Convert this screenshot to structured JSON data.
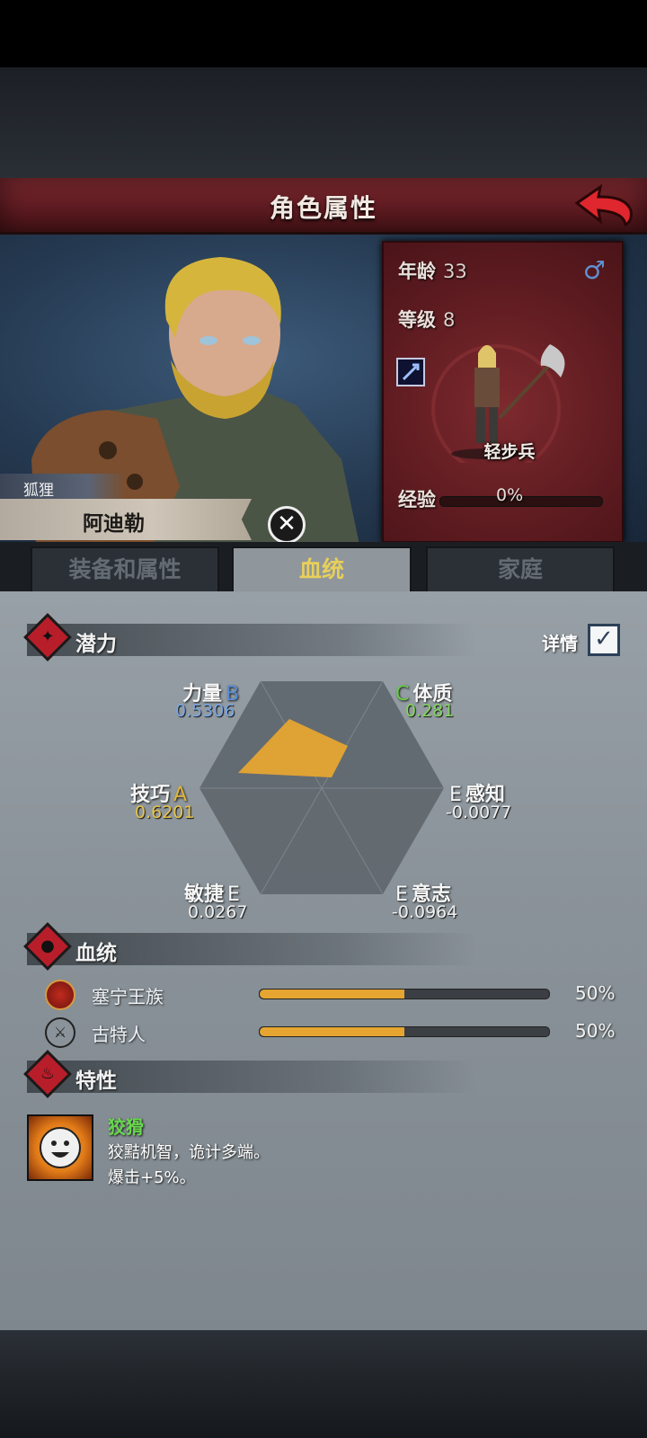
{
  "header": {
    "title": "角色属性"
  },
  "character": {
    "tag": "狐狸",
    "name": "阿迪勒",
    "age_label": "年龄",
    "age": "33",
    "level_label": "等级",
    "level": "8",
    "unit_type": "轻步兵",
    "exp_label": "经验",
    "exp_value": "0%",
    "exp_fraction": 0,
    "gender_icon": "male-symbol-icon"
  },
  "tabs": [
    {
      "label": "装备和属性",
      "active": false
    },
    {
      "label": "血统",
      "active": true
    },
    {
      "label": "家庭",
      "active": false
    }
  ],
  "potential": {
    "title": "潜力",
    "detail_label": "详情",
    "detail_checked": true,
    "stats": [
      {
        "name": "力量",
        "grade": "B",
        "value": "0.5306"
      },
      {
        "name": "体质",
        "grade": "C",
        "value": "0.281"
      },
      {
        "name": "感知",
        "grade": "E",
        "value": "-0.0077"
      },
      {
        "name": "意志",
        "grade": "E",
        "value": "-0.0964"
      },
      {
        "name": "敏捷",
        "grade": "E",
        "value": "0.0267"
      },
      {
        "name": "技巧",
        "grade": "A",
        "value": "0.6201"
      }
    ]
  },
  "lineage": {
    "title": "血统",
    "items": [
      {
        "name": "塞宁王族",
        "percent": "50%",
        "fraction": 0.5
      },
      {
        "name": "古特人",
        "percent": "50%",
        "fraction": 0.5
      }
    ]
  },
  "traits": {
    "title": "特性",
    "items": [
      {
        "name": "狡猾",
        "desc_line1": "狡黠机智，诡计多端。",
        "desc_line2": "爆击+5%。"
      }
    ]
  },
  "colors": {
    "grade_A": "#e0b43c",
    "grade_B": "#5b8fd6",
    "grade_C": "#69c94b",
    "grade_E": "#e8e8e8",
    "radar_fill": "#e6a530",
    "trait_name": "#69d84e"
  }
}
